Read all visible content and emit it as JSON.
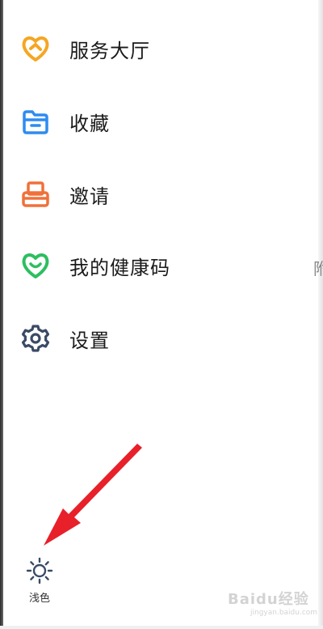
{
  "menu": {
    "items": [
      {
        "label": "服务大厅",
        "icon": "service-hall-icon",
        "color": "#F5A623"
      },
      {
        "label": "收藏",
        "icon": "favorites-folder-icon",
        "color": "#2D8CF0"
      },
      {
        "label": "邀请",
        "icon": "invite-icon",
        "color": "#F0703A"
      },
      {
        "label": "我的健康码",
        "icon": "health-code-icon",
        "color": "#2DBE60"
      },
      {
        "label": "设置",
        "icon": "settings-gear-icon",
        "color": "#3A4A66"
      }
    ],
    "right_clipped_text": "附"
  },
  "theme_toggle": {
    "label": "浅色",
    "icon": "sun-icon"
  },
  "annotation": {
    "arrow_color": "#E8202A",
    "icon": "red-arrow-annotation"
  },
  "watermark": {
    "main": "Baidu经验",
    "sub": "jingyan.baidu.com"
  }
}
